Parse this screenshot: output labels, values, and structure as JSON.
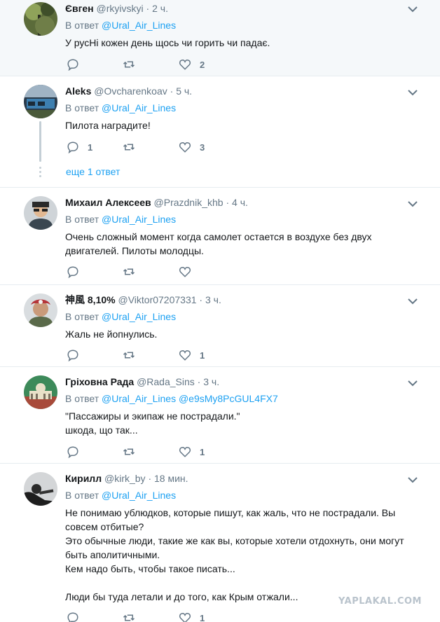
{
  "tweets": [
    {
      "name": "Євген",
      "handle": "@rkyivskyi",
      "dot": "·",
      "time": "2 ч.",
      "reply_prefix": "В ответ",
      "mentions": "@Ural_Air_Lines",
      "text": "У русНі кожен день щось чи горить чи падає.",
      "replies": "",
      "retweets": "",
      "likes": "2",
      "highlight": true
    },
    {
      "name": "Aleks",
      "handle": "@Ovcharenkoav",
      "dot": "·",
      "time": "5 ч.",
      "reply_prefix": "В ответ",
      "mentions": "@Ural_Air_Lines",
      "text": "Пилота наградите!",
      "replies": "1",
      "retweets": "",
      "likes": "3",
      "more_replies": "еще 1 ответ"
    },
    {
      "name": "Михаил Алексеев",
      "handle": "@Prazdnik_khb",
      "dot": "·",
      "time": "4 ч.",
      "reply_prefix": "В ответ",
      "mentions": "@Ural_Air_Lines",
      "text": "Очень сложный момент когда самолет остается в воздухе без двух двигателей. Пилоты молодцы.",
      "replies": "",
      "retweets": "",
      "likes": ""
    },
    {
      "name": "神風 8,10%",
      "handle": "@Viktor07207331",
      "dot": "·",
      "time": "3 ч.",
      "reply_prefix": "В ответ",
      "mentions": "@Ural_Air_Lines",
      "text": "Жаль не йопнулись.",
      "replies": "",
      "retweets": "",
      "likes": "1"
    },
    {
      "name": "Гріховна Рада",
      "handle": "@Rada_Sins",
      "dot": "·",
      "time": "3 ч.",
      "reply_prefix": "В ответ",
      "mentions": "@Ural_Air_Lines @e9sMy8PcGUL4FX7",
      "text": "\"Пассажиры и экипаж не пострадали.\"\nшкода, що так...",
      "replies": "",
      "retweets": "",
      "likes": "1"
    },
    {
      "name": "Кирилл",
      "handle": "@kirk_by",
      "dot": "·",
      "time": "18 мин.",
      "reply_prefix": "В ответ",
      "mentions": "@Ural_Air_Lines",
      "text": "Не понимаю ублюдков, которые пишут, как жаль, что не пострадали. Вы совсем отбитые?\nЭто обычные люди, такие же как вы, которые хотели отдохнуть, они могут быть аполитичными.\nКем надо быть, чтобы такое писать...\n\nЛюди бы туда летали и до того, как Крым отжали...",
      "replies": "",
      "retweets": "",
      "likes": "1"
    }
  ],
  "watermark": "YAPLAKAL.COM",
  "colors": {
    "link": "#1da1f2",
    "muted": "#657786",
    "highlight_bg": "#f5f8fa",
    "divider": "#e6ecf0"
  },
  "icons": [
    "reply-icon",
    "retweet-icon",
    "like-icon",
    "chevron-down-icon"
  ]
}
